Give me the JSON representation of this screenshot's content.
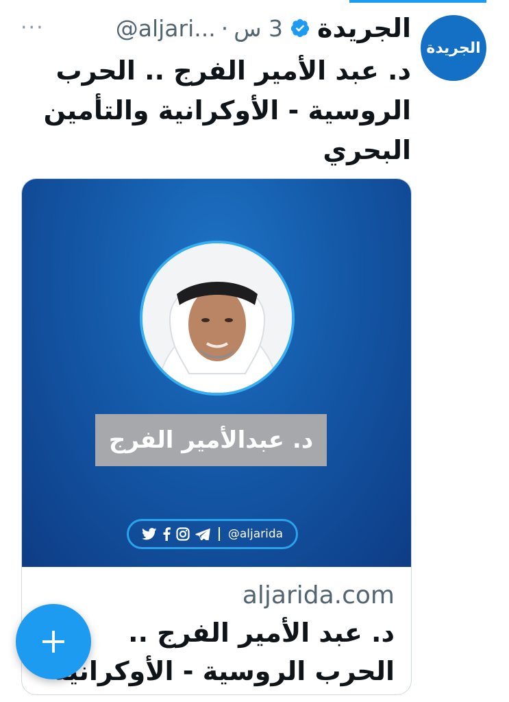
{
  "tweet": {
    "display_name": "الجريدة",
    "handle": "@aljari...",
    "separator": "·",
    "time": "3 س",
    "more_label": "···",
    "avatar_text": "الجريدة",
    "text": "د. عبد الأمير الفرج .. الحرب الروسية - الأوكرانية والتأمين البحري"
  },
  "card": {
    "name_plate": "د. عبدالأمير الفرج",
    "social_handle": "@aljarida",
    "social_icons": [
      "twitter-icon",
      "facebook-icon",
      "instagram-icon",
      "telegram-icon"
    ],
    "domain": "aljarida.com",
    "title_line1": "د. عبد الأمير الفرج ..",
    "title_line2": "الحرب الروسية - الأوكرانية"
  },
  "colors": {
    "accent": "#1d9bf0",
    "card_blue": "#1459a8",
    "name_plate": "#a7a8ab"
  }
}
